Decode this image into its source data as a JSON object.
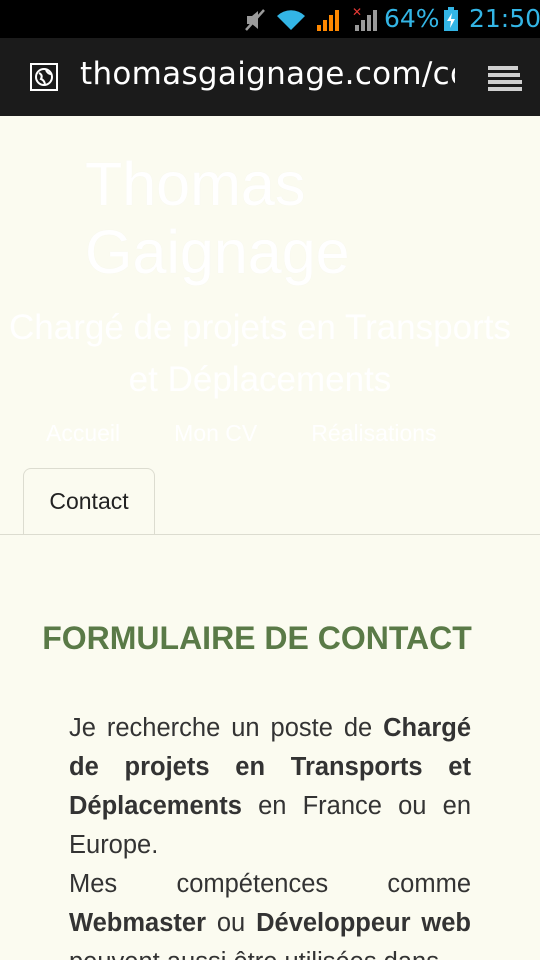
{
  "status_bar": {
    "battery_percent": "64%",
    "time": "21:50",
    "icons": [
      "mute-icon",
      "wifi-icon",
      "signal-icon",
      "no-signal-icon",
      "battery-charging-icon"
    ],
    "accent": "#33b5e5"
  },
  "browser": {
    "url": "thomasgaignage.com/contact",
    "site_icon": "globe-icon",
    "menu_icon": "tabs-stack-icon"
  },
  "header": {
    "title": "Thomas Gaignage",
    "subtitle": "Chargé de projets en Transports et Déplacements"
  },
  "nav": {
    "items": [
      {
        "label": "Accueil"
      },
      {
        "label": "Mon CV"
      },
      {
        "label": "Réalisations"
      },
      {
        "label": "Contact",
        "active": true
      }
    ]
  },
  "content": {
    "heading": "FORMULAIRE DE CONTACT",
    "heading_color": "#5a7a47",
    "p1_a": "Je recherche un poste de ",
    "p1_b": "Chargé de projets en Transports et Déplacements",
    "p1_c": " en France ou en Europe.",
    "p2_a": "Mes compétences comme ",
    "p2_b": "Webmaster",
    "p2_c": " ou ",
    "p2_d": "Développeur web",
    "p2_e": " peuvent aussi être utilisées dans"
  }
}
